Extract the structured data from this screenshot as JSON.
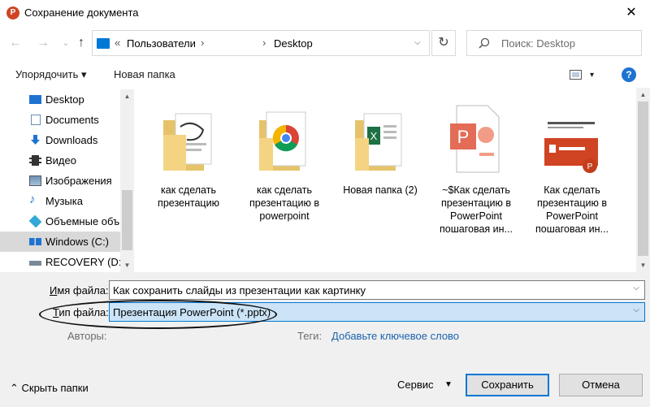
{
  "window": {
    "title": "Сохранение документа",
    "app_icon_letter": "P",
    "close_glyph": "✕"
  },
  "nav": {
    "back_glyph": "←",
    "forward_glyph": "→",
    "recent_glyph": "⌄",
    "up_glyph": "↑",
    "breadcrumb_prefix": "«",
    "breadcrumb": [
      "Пользователи",
      "Desktop"
    ],
    "crumb_sep": "›",
    "refresh_glyph": "↻",
    "search_placeholder": "Поиск: Desktop"
  },
  "toolbar": {
    "organize_label": "Упорядочить ▾",
    "new_folder_label": "Новая папка",
    "view_arrow": "▾",
    "help_label": "?"
  },
  "sidebar": {
    "items": [
      {
        "label": "Desktop",
        "icon": "desktop-icon",
        "color": "#1e73d1"
      },
      {
        "label": "Documents",
        "icon": "documents-icon",
        "color": "#6b8fb3"
      },
      {
        "label": "Downloads",
        "icon": "downloads-icon",
        "color": "#1e73d1"
      },
      {
        "label": "Видео",
        "icon": "video-icon",
        "color": "#333333"
      },
      {
        "label": "Изображения",
        "icon": "pictures-icon",
        "color": "#6b8fb3"
      },
      {
        "label": "Музыка",
        "icon": "music-icon",
        "color": "#1e73d1"
      },
      {
        "label": "Объемные объ",
        "icon": "3d-objects-icon",
        "color": "#34a8d8"
      },
      {
        "label": "Windows (C:)",
        "icon": "drive-c-icon",
        "color": "#7a8a99"
      },
      {
        "label": "RECOVERY (D:)",
        "icon": "drive-d-icon",
        "color": "#7a8a99"
      }
    ],
    "selected_index": 7
  },
  "files": [
    {
      "label": "как сделать презентацию",
      "type": "folder-with-doc"
    },
    {
      "label": "как сделать презентацию в powerpoint",
      "type": "folder-chrome"
    },
    {
      "label": "Новая папка (2)",
      "type": "folder-excel"
    },
    {
      "label": "~$Как сделать презентацию в PowerPoint пошаговая ин...",
      "type": "pptx"
    },
    {
      "label": "Как сделать презентацию в PowerPoint пошаговая ин...",
      "type": "pptx-thumb"
    }
  ],
  "form": {
    "filename_label_u": "И",
    "filename_label_rest": "мя файла:",
    "filename_value": "Как сохранить слайды из презентации как картинку",
    "filetype_label_u": "Т",
    "filetype_label_rest": "ип файла:",
    "filetype_value": "Презентация PowerPoint (*.pptx)",
    "authors_label": "Авторы:",
    "tags_label": "Теги:",
    "tags_link": "Добавьте ключевое слово",
    "dropdown_glyph": "⌵"
  },
  "footer": {
    "hide_folders_label": "⌃  Скрыть папки",
    "service_label": "Сервис",
    "service_arrow": "▼",
    "save_label": "Сохранить",
    "cancel_label": "Отмена"
  },
  "colors": {
    "accent": "#0078d7",
    "link": "#1a63b0",
    "selection": "#cce4f7",
    "powerpoint": "#d04423"
  }
}
